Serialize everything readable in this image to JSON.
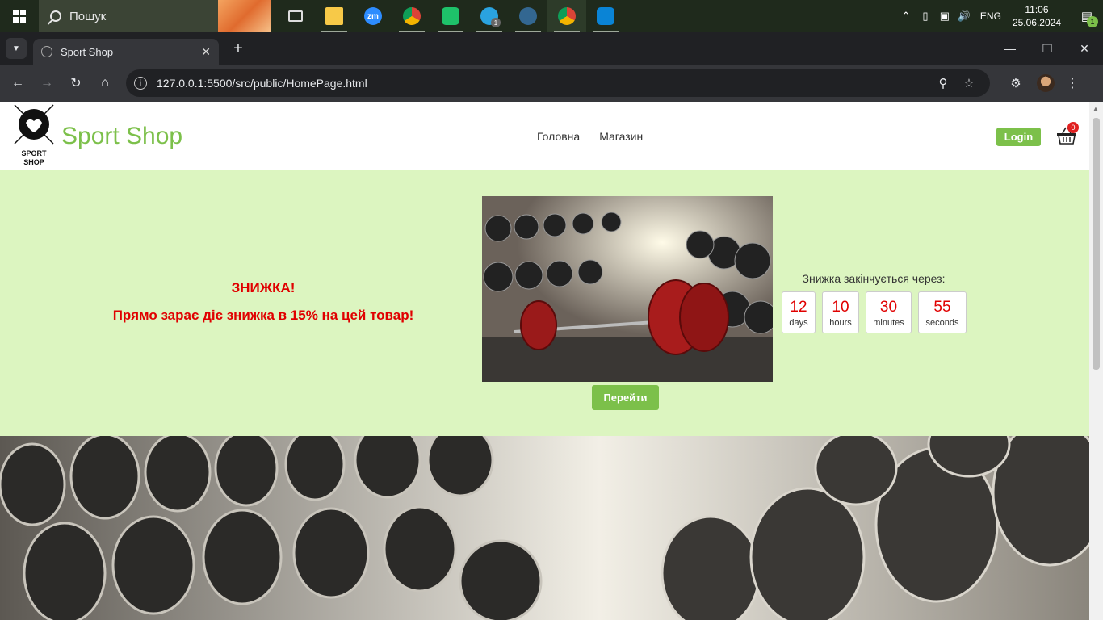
{
  "taskbar": {
    "search_placeholder": "Пошук",
    "apps": [
      "task-view",
      "file-explorer",
      "zoom",
      "chrome",
      "green-app",
      "telegram",
      "postgresql",
      "chrome",
      "vscode"
    ],
    "telegram_badge": "1",
    "language": "ENG",
    "time": "11:06",
    "date": "25.06.2024",
    "notifications_count": "1"
  },
  "browser": {
    "tab_title": "Sport Shop",
    "url": "127.0.0.1:5500/src/public/HomePage.html"
  },
  "site": {
    "logo_text_line1": "SPORT",
    "logo_text_line2": "SHOP",
    "brand": "Sport Shop",
    "nav": [
      {
        "label": "Головна"
      },
      {
        "label": "Магазин"
      }
    ],
    "login_label": "Login",
    "cart_count": "0",
    "promo": {
      "title": "ЗНИЖКА!",
      "text": "Прямо зарає діє знижка в 15% на цей товар!",
      "button_label": "Перейти",
      "countdown_label": "Знижка закінчується через:",
      "countdown": [
        {
          "value": "12",
          "unit": "days"
        },
        {
          "value": "10",
          "unit": "hours"
        },
        {
          "value": "30",
          "unit": "minutes"
        },
        {
          "value": "55",
          "unit": "seconds"
        }
      ]
    }
  },
  "colors": {
    "brand_green": "#7cc04a",
    "promo_bg": "#dcf5c0",
    "promo_red": "#e00000",
    "cart_badge": "#e02020"
  }
}
